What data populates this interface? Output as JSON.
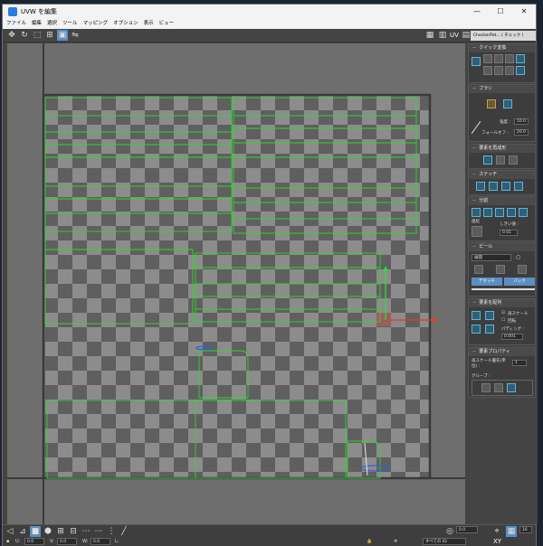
{
  "window": {
    "title": "UVW を編集"
  },
  "titlebar": {
    "minimize": "—",
    "maximize": "☐",
    "close": "✕"
  },
  "menu": [
    "ファイル",
    "編集",
    "選択",
    "ツール",
    "マッピング",
    "オプション",
    "表示",
    "ビュー"
  ],
  "toolbar": {
    "uv_label": "UV",
    "texture_select": "CheckerPat... ( チェック )"
  },
  "panel": {
    "quick_transform": {
      "title": "クイック変換"
    },
    "brush": {
      "title": "ブラシ",
      "strength_label": "強度 :",
      "strength_value": "10.0",
      "falloff_label": "フォールオフ :",
      "falloff_value": "20.0"
    },
    "reshape": {
      "title": "要素を再成形"
    },
    "stitch": {
      "title": "ステッチ"
    },
    "split": {
      "title": "分割",
      "link_label": "連結",
      "threshold_label": "しきい値 :",
      "threshold_value": "0.01"
    },
    "peel": {
      "title": "ピール",
      "mode_value": "展開",
      "detach_label": "デタッチ",
      "pack_label": "パック"
    },
    "arrange": {
      "title": "要素を配列",
      "rescale_label": "再スケール",
      "rotate_label": "回転",
      "padding_label": "パディング :",
      "padding_value": "0.001"
    },
    "properties": {
      "title": "要素プロパティ",
      "rescale_priority_label": "再スケール優先(単位) :",
      "rescale_priority_value": "1",
      "group_label": "グループ :"
    }
  },
  "bottom": {
    "u_label": "U:",
    "u_value": "0.0",
    "v_label": "V:",
    "v_value": "0.0",
    "w_label": "W:",
    "w_value": "0.0",
    "l_label": "L:",
    "zoom_value": "0.0",
    "grid_value": "16",
    "xy_label": "XY",
    "id_select": "すべての ID"
  },
  "colors": {
    "uv_edge": "#2fd62f",
    "selection": "#5a8fc2",
    "gizmo_x": "#e03a3a",
    "gizmo_y": "#31d64a",
    "icon_border": "#5fb6d4"
  }
}
